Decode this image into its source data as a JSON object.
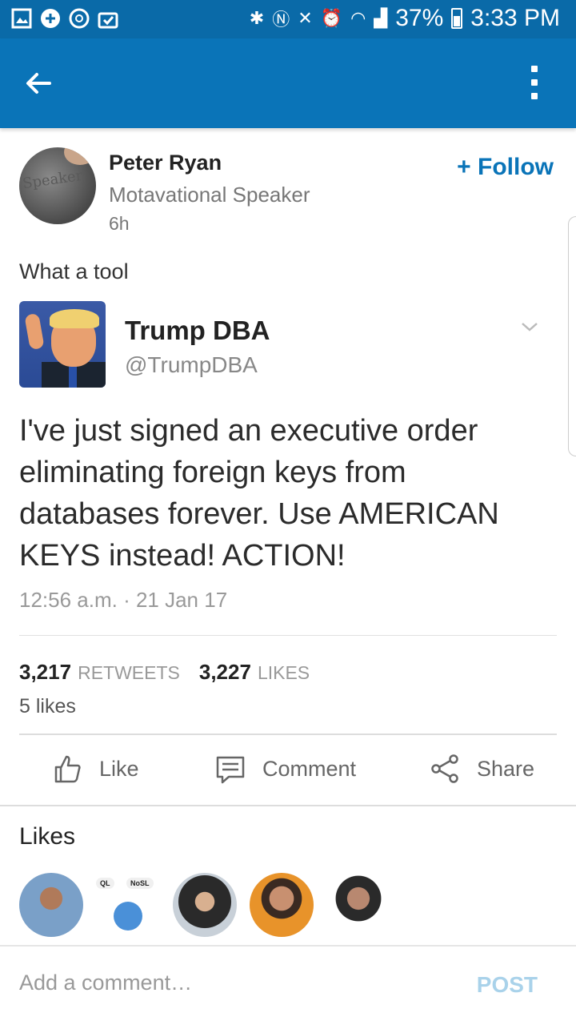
{
  "status_bar": {
    "battery": "37%",
    "time": "3:33 PM"
  },
  "post": {
    "author_name": "Peter Ryan",
    "author_title": "Motavational Speaker",
    "time_ago": "6h",
    "follow_label": "+ Follow",
    "text": "What a tool",
    "avatar_stamp_text": "Speaker"
  },
  "tweet": {
    "name": "Trump DBA",
    "handle": "@TrumpDBA",
    "body": "I've just signed an executive order eliminating foreign keys from databases forever. Use AMERICAN KEYS instead! ACTION!",
    "date": "12:56 a.m. · 21 Jan 17",
    "retweets_count": "3,217",
    "retweets_label": "RETWEETS",
    "likes_count": "3,227",
    "likes_label": "LIKES"
  },
  "post_likes_text": "5 likes",
  "actions": {
    "like": "Like",
    "comment": "Comment",
    "share": "Share"
  },
  "likes_section": {
    "title": "Likes",
    "liker2_bubble_left": "QL",
    "liker2_bubble_right": "NoSL"
  },
  "comment_bar": {
    "placeholder": "Add a comment…",
    "post_label": "POST"
  },
  "colors": {
    "status_bar": "#0a6aa8",
    "app_bar": "#0a74b8",
    "accent": "#0a74b8",
    "post_disabled": "#a9d2ea"
  }
}
